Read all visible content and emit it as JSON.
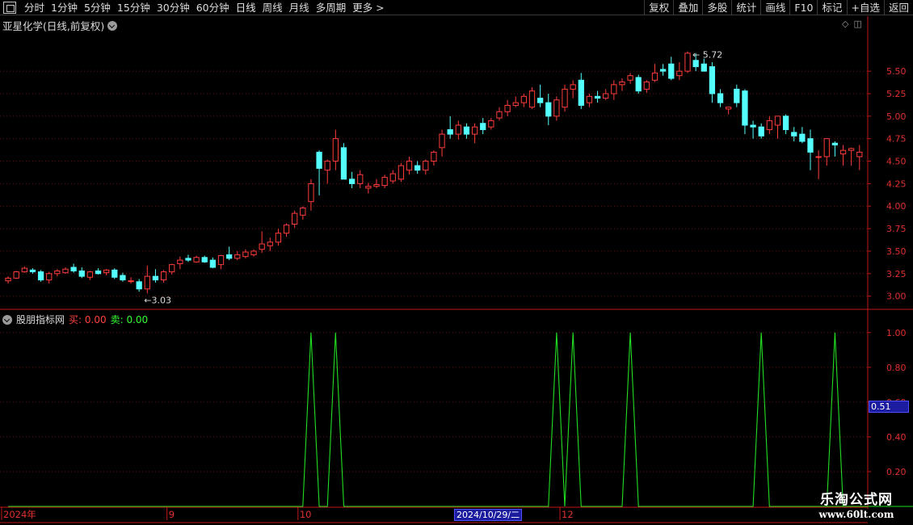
{
  "toolbar": {
    "periods": [
      "分时",
      "1分钟",
      "5分钟",
      "15分钟",
      "30分钟",
      "60分钟",
      "日线",
      "周线",
      "月线",
      "多周期",
      "更多 >"
    ],
    "tools": [
      "复权",
      "叠加",
      "多股",
      "统计",
      "画线",
      "F10",
      "标记",
      "+自选",
      "返回"
    ]
  },
  "stock_title": "亚星化学(日线,前复权)",
  "indicator": {
    "name": "股朋指标网",
    "buy_label": "买: 0.00",
    "sell_label": "卖: 0.00"
  },
  "cursor_value": "0.51",
  "cursor_date": "2024/10/29/二",
  "watermark": {
    "title": "乐淘公式网",
    "url": "www.60lt.com"
  },
  "colors": {
    "up": "#ff3c3c",
    "down": "#54ffff",
    "signal": "#22dd22",
    "axis": "#c01818"
  },
  "chart_data": [
    {
      "type": "candlestick",
      "title": "亚星化学(日线,前复权)",
      "ylim": [
        2.88,
        5.95
      ],
      "y_ticks": [
        3.0,
        3.25,
        3.5,
        3.75,
        4.0,
        4.25,
        4.5,
        4.75,
        5.0,
        5.25,
        5.5
      ],
      "x_tick_labels": [
        {
          "index": 0,
          "label": "2024年"
        },
        {
          "index": 20,
          "label": "9"
        },
        {
          "index": 36,
          "label": "10"
        },
        {
          "index": 68,
          "label": "12"
        }
      ],
      "high_label": "5.72",
      "low_label": "3.03",
      "candles": [
        [
          3.17,
          3.22,
          3.14,
          3.2
        ],
        [
          3.2,
          3.28,
          3.19,
          3.27
        ],
        [
          3.27,
          3.33,
          3.26,
          3.31
        ],
        [
          3.29,
          3.31,
          3.25,
          3.27
        ],
        [
          3.27,
          3.29,
          3.16,
          3.18
        ],
        [
          3.18,
          3.27,
          3.14,
          3.25
        ],
        [
          3.25,
          3.3,
          3.22,
          3.28
        ],
        [
          3.26,
          3.32,
          3.25,
          3.3
        ],
        [
          3.32,
          3.36,
          3.26,
          3.28
        ],
        [
          3.28,
          3.32,
          3.2,
          3.22
        ],
        [
          3.21,
          3.28,
          3.18,
          3.27
        ],
        [
          3.28,
          3.31,
          3.24,
          3.25
        ],
        [
          3.26,
          3.3,
          3.23,
          3.29
        ],
        [
          3.29,
          3.31,
          3.19,
          3.21
        ],
        [
          3.23,
          3.26,
          3.16,
          3.18
        ],
        [
          3.17,
          3.21,
          3.14,
          3.17
        ],
        [
          3.16,
          3.19,
          3.05,
          3.08
        ],
        [
          3.08,
          3.34,
          3.03,
          3.22
        ],
        [
          3.22,
          3.3,
          3.15,
          3.18
        ],
        [
          3.18,
          3.29,
          3.15,
          3.27
        ],
        [
          3.27,
          3.36,
          3.24,
          3.35
        ],
        [
          3.36,
          3.44,
          3.3,
          3.4
        ],
        [
          3.42,
          3.46,
          3.38,
          3.4
        ],
        [
          3.38,
          3.45,
          3.37,
          3.43
        ],
        [
          3.43,
          3.45,
          3.37,
          3.38
        ],
        [
          3.4,
          3.43,
          3.31,
          3.32
        ],
        [
          3.35,
          3.46,
          3.3,
          3.45
        ],
        [
          3.46,
          3.55,
          3.4,
          3.42
        ],
        [
          3.42,
          3.5,
          3.4,
          3.46
        ],
        [
          3.44,
          3.52,
          3.42,
          3.49
        ],
        [
          3.46,
          3.52,
          3.44,
          3.5
        ],
        [
          3.52,
          3.72,
          3.48,
          3.58
        ],
        [
          3.56,
          3.65,
          3.5,
          3.6
        ],
        [
          3.6,
          3.75,
          3.56,
          3.7
        ],
        [
          3.7,
          3.81,
          3.66,
          3.79
        ],
        [
          3.8,
          3.95,
          3.76,
          3.92
        ],
        [
          3.9,
          4.0,
          3.85,
          3.98
        ],
        [
          4.05,
          4.3,
          3.95,
          4.25
        ],
        [
          4.6,
          4.62,
          4.12,
          4.42
        ],
        [
          4.4,
          4.52,
          4.25,
          4.5
        ],
        [
          4.5,
          4.85,
          4.4,
          4.75
        ],
        [
          4.65,
          4.7,
          4.35,
          4.3
        ],
        [
          4.3,
          4.38,
          4.2,
          4.25
        ],
        [
          4.25,
          4.4,
          4.2,
          4.35
        ],
        [
          4.2,
          4.26,
          4.14,
          4.22
        ],
        [
          4.22,
          4.3,
          4.2,
          4.24
        ],
        [
          4.23,
          4.35,
          4.2,
          4.32
        ],
        [
          4.28,
          4.4,
          4.25,
          4.36
        ],
        [
          4.3,
          4.48,
          4.27,
          4.45
        ],
        [
          4.4,
          4.55,
          4.35,
          4.5
        ],
        [
          4.45,
          4.5,
          4.36,
          4.4
        ],
        [
          4.4,
          4.52,
          4.35,
          4.5
        ],
        [
          4.5,
          4.62,
          4.45,
          4.6
        ],
        [
          4.65,
          4.85,
          4.55,
          4.8
        ],
        [
          4.85,
          5.0,
          4.75,
          4.8
        ],
        [
          4.8,
          4.95,
          4.74,
          4.9
        ],
        [
          4.88,
          4.92,
          4.75,
          4.8
        ],
        [
          4.8,
          4.92,
          4.7,
          4.88
        ],
        [
          4.92,
          4.98,
          4.8,
          4.85
        ],
        [
          4.88,
          4.98,
          4.85,
          4.95
        ],
        [
          4.98,
          5.1,
          4.95,
          5.05
        ],
        [
          5.05,
          5.18,
          5.0,
          5.12
        ],
        [
          5.12,
          5.22,
          5.1,
          5.15
        ],
        [
          5.15,
          5.25,
          5.1,
          5.22
        ],
        [
          5.1,
          5.32,
          5.08,
          5.28
        ],
        [
          5.2,
          5.35,
          5.1,
          5.15
        ],
        [
          5.15,
          5.25,
          4.9,
          5.0
        ],
        [
          5.0,
          5.22,
          4.95,
          5.18
        ],
        [
          5.1,
          5.35,
          5.05,
          5.3
        ],
        [
          5.3,
          5.4,
          5.2,
          5.35
        ],
        [
          5.4,
          5.48,
          5.08,
          5.12
        ],
        [
          5.15,
          5.25,
          5.1,
          5.22
        ],
        [
          5.22,
          5.28,
          5.15,
          5.2
        ],
        [
          5.2,
          5.3,
          5.18,
          5.25
        ],
        [
          5.25,
          5.4,
          5.18,
          5.35
        ],
        [
          5.35,
          5.42,
          5.28,
          5.38
        ],
        [
          5.4,
          5.48,
          5.36,
          5.45
        ],
        [
          5.43,
          5.46,
          5.25,
          5.28
        ],
        [
          5.3,
          5.4,
          5.26,
          5.38
        ],
        [
          5.4,
          5.58,
          5.38,
          5.48
        ],
        [
          5.52,
          5.58,
          5.45,
          5.5
        ],
        [
          5.58,
          5.66,
          5.4,
          5.42
        ],
        [
          5.45,
          5.6,
          5.4,
          5.5
        ],
        [
          5.5,
          5.72,
          5.48,
          5.7
        ],
        [
          5.62,
          5.7,
          5.5,
          5.55
        ],
        [
          5.58,
          5.64,
          5.5,
          5.5
        ],
        [
          5.55,
          5.6,
          5.15,
          5.25
        ],
        [
          5.25,
          5.3,
          5.1,
          5.15
        ],
        [
          5.08,
          5.1,
          5.02,
          5.1
        ],
        [
          5.3,
          5.35,
          5.1,
          5.15
        ],
        [
          5.28,
          5.3,
          4.8,
          4.9
        ],
        [
          4.9,
          4.95,
          4.75,
          4.88
        ],
        [
          4.88,
          4.92,
          4.75,
          4.78
        ],
        [
          4.85,
          5.0,
          4.8,
          4.95
        ],
        [
          4.9,
          5.0,
          4.75,
          5.0
        ],
        [
          5.0,
          5.02,
          4.8,
          4.85
        ],
        [
          4.82,
          4.88,
          4.72,
          4.78
        ],
        [
          4.8,
          4.88,
          4.7,
          4.72
        ],
        [
          4.75,
          4.85,
          4.4,
          4.6
        ],
        [
          4.55,
          4.62,
          4.3,
          4.55
        ],
        [
          4.55,
          4.75,
          4.45,
          4.75
        ],
        [
          4.7,
          4.72,
          4.55,
          4.68
        ],
        [
          4.58,
          4.68,
          4.45,
          4.62
        ],
        [
          4.62,
          4.65,
          4.45,
          4.64
        ],
        [
          4.55,
          4.68,
          4.4,
          4.6
        ]
      ]
    },
    {
      "type": "line",
      "title": "股朋指标网",
      "ylim": [
        0,
        1.05
      ],
      "y_ticks": [
        0.2,
        0.4,
        0.6,
        0.8,
        1.0
      ],
      "series": [
        {
          "name": "买",
          "values": [
            0,
            0,
            0,
            0,
            0,
            0,
            0,
            0,
            0,
            0,
            0,
            0,
            0,
            0,
            0,
            0,
            0,
            0,
            0,
            0,
            0,
            0,
            0,
            0,
            0,
            0,
            0,
            0,
            0,
            0,
            0,
            0,
            0,
            0,
            0,
            0,
            0,
            1,
            0,
            0,
            1,
            0,
            0,
            0,
            0,
            0,
            0,
            0,
            0,
            0,
            0,
            0,
            0,
            0,
            0,
            0,
            0,
            0,
            0,
            0,
            0,
            0,
            0,
            0,
            0,
            0,
            0,
            1,
            0,
            1,
            0,
            0,
            0,
            0,
            0,
            0,
            1,
            0,
            0,
            0,
            0,
            0,
            0,
            0,
            0,
            0,
            0,
            0,
            0,
            0,
            0,
            0,
            1,
            0,
            0,
            0,
            0,
            0,
            0,
            0,
            0,
            1,
            0,
            0,
            0,
            0,
            0,
            0,
            0,
            0,
            0,
            0,
            0,
            0,
            0,
            0,
            0,
            0,
            0,
            0,
            0
          ]
        }
      ]
    }
  ]
}
